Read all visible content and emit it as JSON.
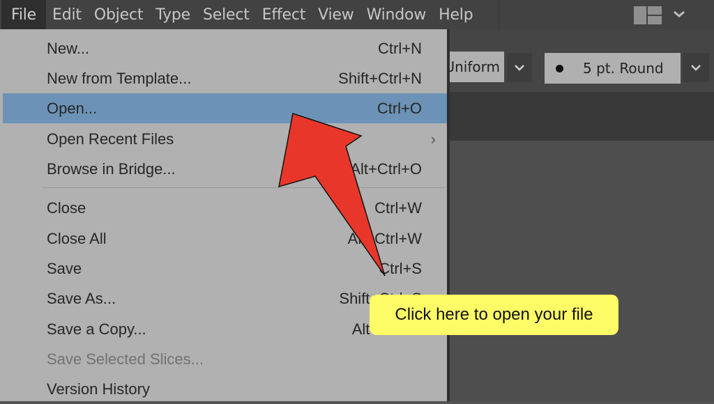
{
  "menubar": {
    "menus": [
      {
        "label": "File",
        "active": true
      },
      {
        "label": "Edit"
      },
      {
        "label": "Object"
      },
      {
        "label": "Type"
      },
      {
        "label": "Select"
      },
      {
        "label": "Effect"
      },
      {
        "label": "View"
      },
      {
        "label": "Window"
      },
      {
        "label": "Help"
      }
    ],
    "workspace_icon": "workspace-layout-icon",
    "workspace_chevron": "chevron-down-icon"
  },
  "controlbar": {
    "profile_value": "Uniform",
    "brush_value": "5 pt. Round",
    "brush_dot_icon": "round-brush-dot-icon",
    "chevron_icon": "chevron-down-icon"
  },
  "file_menu": {
    "items": [
      {
        "label": "New...",
        "shortcut": "Ctrl+N"
      },
      {
        "label": "New from Template...",
        "shortcut": "Shift+Ctrl+N"
      },
      {
        "label": "Open...",
        "shortcut": "Ctrl+O",
        "highlighted": true
      },
      {
        "label": "Open Recent Files",
        "shortcut": "",
        "submenu": "›"
      },
      {
        "label": "Browse in Bridge...",
        "shortcut": "Alt+Ctrl+O"
      },
      {
        "label": "Close",
        "shortcut": "Ctrl+W"
      },
      {
        "label": "Close All",
        "shortcut": "Alt+Ctrl+W"
      },
      {
        "label": "Save",
        "shortcut": "Ctrl+S"
      },
      {
        "label": "Save As...",
        "shortcut": "Shift+Ctrl+S"
      },
      {
        "label": "Save a Copy...",
        "shortcut": "Alt+Ctrl+S"
      },
      {
        "label": "Save Selected Slices...",
        "shortcut": "",
        "disabled": true
      },
      {
        "label": "Version History",
        "shortcut": ""
      }
    ]
  },
  "annotation": {
    "callout_text": "Click here to open your file",
    "arrow_color": "#e8372a",
    "callout_color": "#fdfb66"
  },
  "colors": {
    "menubar_bg": "#424242",
    "menu_bg": "#b1b1b1",
    "highlight": "#6c93b7"
  }
}
